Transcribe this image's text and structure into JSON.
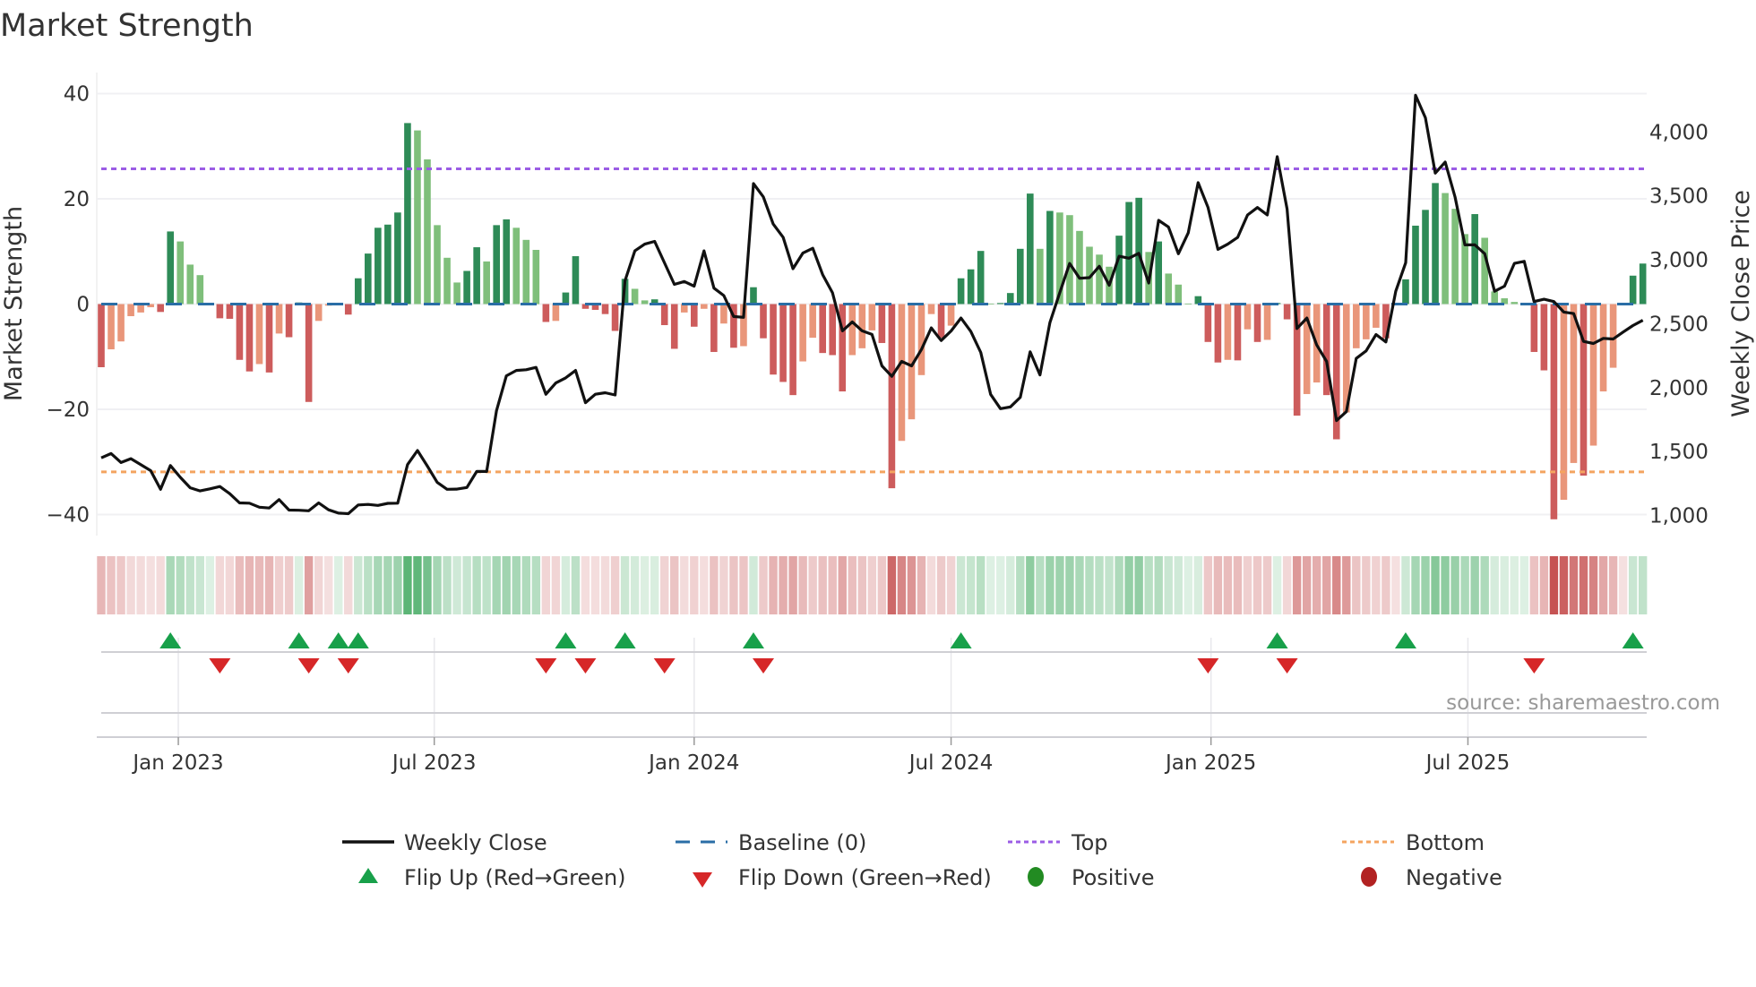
{
  "title": "Market Strength",
  "source": "source: sharemaestro.com",
  "colors": {
    "pos_strong": "#2e8b57",
    "pos_weak": "#7fbf7b",
    "neg_strong": "#cd5c5c",
    "neg_weak": "#e9967a",
    "close": "#111111",
    "baseline": "#2a6ea6",
    "top": "#9b5de5",
    "bottom": "#f4a460",
    "flip_up": "#18a04a",
    "flip_down": "#d62728",
    "positive_dot": "#228b22",
    "negative_dot": "#b22222"
  },
  "chart_data": {
    "type": "bar",
    "title": "Market Strength",
    "ylabel": "Market Strength",
    "y2label": "Weekly Close Price",
    "ylim": [
      -44,
      44
    ],
    "y2lim": [
      842,
      4465
    ],
    "yticks": [
      40,
      20,
      0,
      -20,
      -40
    ],
    "ytick_labels": [
      "40",
      "20",
      "0",
      "−20",
      "−40"
    ],
    "y2ticks": [
      4000,
      3500,
      3000,
      2500,
      2000,
      1500,
      1000
    ],
    "y2tick_labels": [
      "4,000",
      "3,500",
      "3,000",
      "2,500",
      "2,000",
      "1,500",
      "1,000"
    ],
    "xticks": [
      7.8,
      33.7,
      60.0,
      86.0,
      112.3,
      138.3
    ],
    "xtick_labels": [
      "Jan 2023",
      "Jul 2023",
      "Jan 2024",
      "Jul 2024",
      "Jan 2025",
      "Jul 2025"
    ],
    "top_level": 25.7,
    "bottom_level": -31.9,
    "baseline": 0,
    "strength": [
      -12.0,
      -8.6,
      -7.1,
      -2.3,
      -1.6,
      -0.6,
      -1.5,
      13.8,
      11.9,
      7.5,
      5.5,
      0.2,
      -2.7,
      -2.8,
      -10.6,
      -12.8,
      -11.4,
      -13.0,
      -5.6,
      -6.3,
      0.3,
      -18.6,
      -3.2,
      -0.3,
      0.2,
      -2.0,
      4.9,
      9.6,
      14.5,
      15.1,
      17.4,
      34.4,
      33.0,
      27.5,
      15.0,
      8.8,
      4.1,
      6.3,
      10.8,
      8.1,
      15.0,
      16.1,
      14.5,
      12.2,
      10.3,
      -3.4,
      -3.2,
      2.2,
      9.1,
      -0.9,
      -1.1,
      -1.9,
      -5.1,
      4.8,
      2.9,
      0.7,
      0.9,
      -4.0,
      -8.5,
      -1.6,
      -4.3,
      -0.9,
      -9.1,
      -3.7,
      -8.3,
      -8.0,
      3.2,
      -6.5,
      -13.4,
      -14.8,
      -17.3,
      -10.9,
      -6.4,
      -9.3,
      -9.7,
      -16.6,
      -9.7,
      -8.4,
      -5.0,
      -7.4,
      -35.0,
      -26.0,
      -21.9,
      -13.5,
      -1.9,
      -6.4,
      -4.1,
      4.9,
      6.6,
      10.1,
      0.1,
      0.2,
      2.1,
      10.5,
      21.0,
      10.5,
      17.7,
      17.4,
      16.9,
      13.9,
      10.9,
      9.4,
      7.1,
      13.0,
      19.4,
      20.2,
      9.9,
      11.9,
      5.8,
      3.7,
      0.1,
      1.5,
      -7.2,
      -11.1,
      -10.6,
      -10.7,
      -4.8,
      -7.2,
      -6.8,
      0.2,
      -2.9,
      -21.2,
      -17.1,
      -14.9,
      -17.3,
      -25.7,
      -20.6,
      -8.4,
      -6.7,
      -4.5,
      -6.5,
      -0.1,
      4.7,
      14.9,
      17.9,
      23.0,
      21.1,
      18.1,
      13.3,
      17.1,
      12.6,
      2.4,
      1.1,
      0.4,
      0.1,
      -9.1,
      -12.6,
      -40.9,
      -37.2,
      -30.2,
      -32.6,
      -26.9,
      -16.6,
      -12.1,
      -0.1,
      5.4,
      7.7
    ],
    "close": [
      1450,
      1484,
      1414,
      1444,
      1398,
      1350,
      1204,
      1390,
      1298,
      1216,
      1192,
      1208,
      1226,
      1170,
      1098,
      1096,
      1064,
      1058,
      1124,
      1042,
      1040,
      1036,
      1098,
      1044,
      1018,
      1014,
      1082,
      1086,
      1078,
      1094,
      1096,
      1398,
      1508,
      1386,
      1258,
      1204,
      1206,
      1218,
      1344,
      1344,
      1820,
      2092,
      2134,
      2140,
      2158,
      1948,
      2036,
      2076,
      2134,
      1882,
      1948,
      1960,
      1942,
      2836,
      3070,
      3122,
      3144,
      2976,
      2808,
      2830,
      2794,
      3070,
      2778,
      2720,
      2556,
      2550,
      3596,
      3492,
      3280,
      3176,
      2930,
      3052,
      3090,
      2884,
      2742,
      2444,
      2514,
      2444,
      2416,
      2170,
      2088,
      2205,
      2170,
      2298,
      2467,
      2368,
      2443,
      2544,
      2439,
      2275,
      1947,
      1835,
      1849,
      1924,
      2280,
      2099,
      2509,
      2743,
      2972,
      2855,
      2860,
      2949,
      2801,
      3028,
      3012,
      3051,
      2818,
      3309,
      3257,
      3047,
      3211,
      3604,
      3409,
      3082,
      3122,
      3175,
      3351,
      3409,
      3351,
      3807,
      3398,
      2462,
      2544,
      2333,
      2205,
      1742,
      1812,
      2228,
      2287,
      2415,
      2357,
      2754,
      2977,
      4287,
      4111,
      3678,
      3765,
      3491,
      3117,
      3117,
      3047,
      2754,
      2794,
      2972,
      2988,
      2673,
      2691,
      2673,
      2591,
      2579,
      2361,
      2345,
      2385,
      2380,
      2434,
      2485,
      2527
    ],
    "flips_up": [
      7,
      20,
      24,
      26,
      47,
      53,
      66,
      87,
      119,
      132,
      155
    ],
    "flips_down": [
      12,
      21,
      25,
      45,
      49,
      57,
      67,
      112,
      120,
      145
    ],
    "legend_placement": "bottom-center"
  },
  "legend": {
    "weekly_close": "Weekly Close",
    "baseline": "Baseline (0)",
    "top": "Top",
    "bottom": "Bottom",
    "flip_up": "Flip Up (Red→Green)",
    "flip_down": "Flip Down (Green→Red)",
    "positive": "Positive",
    "negative": "Negative"
  }
}
